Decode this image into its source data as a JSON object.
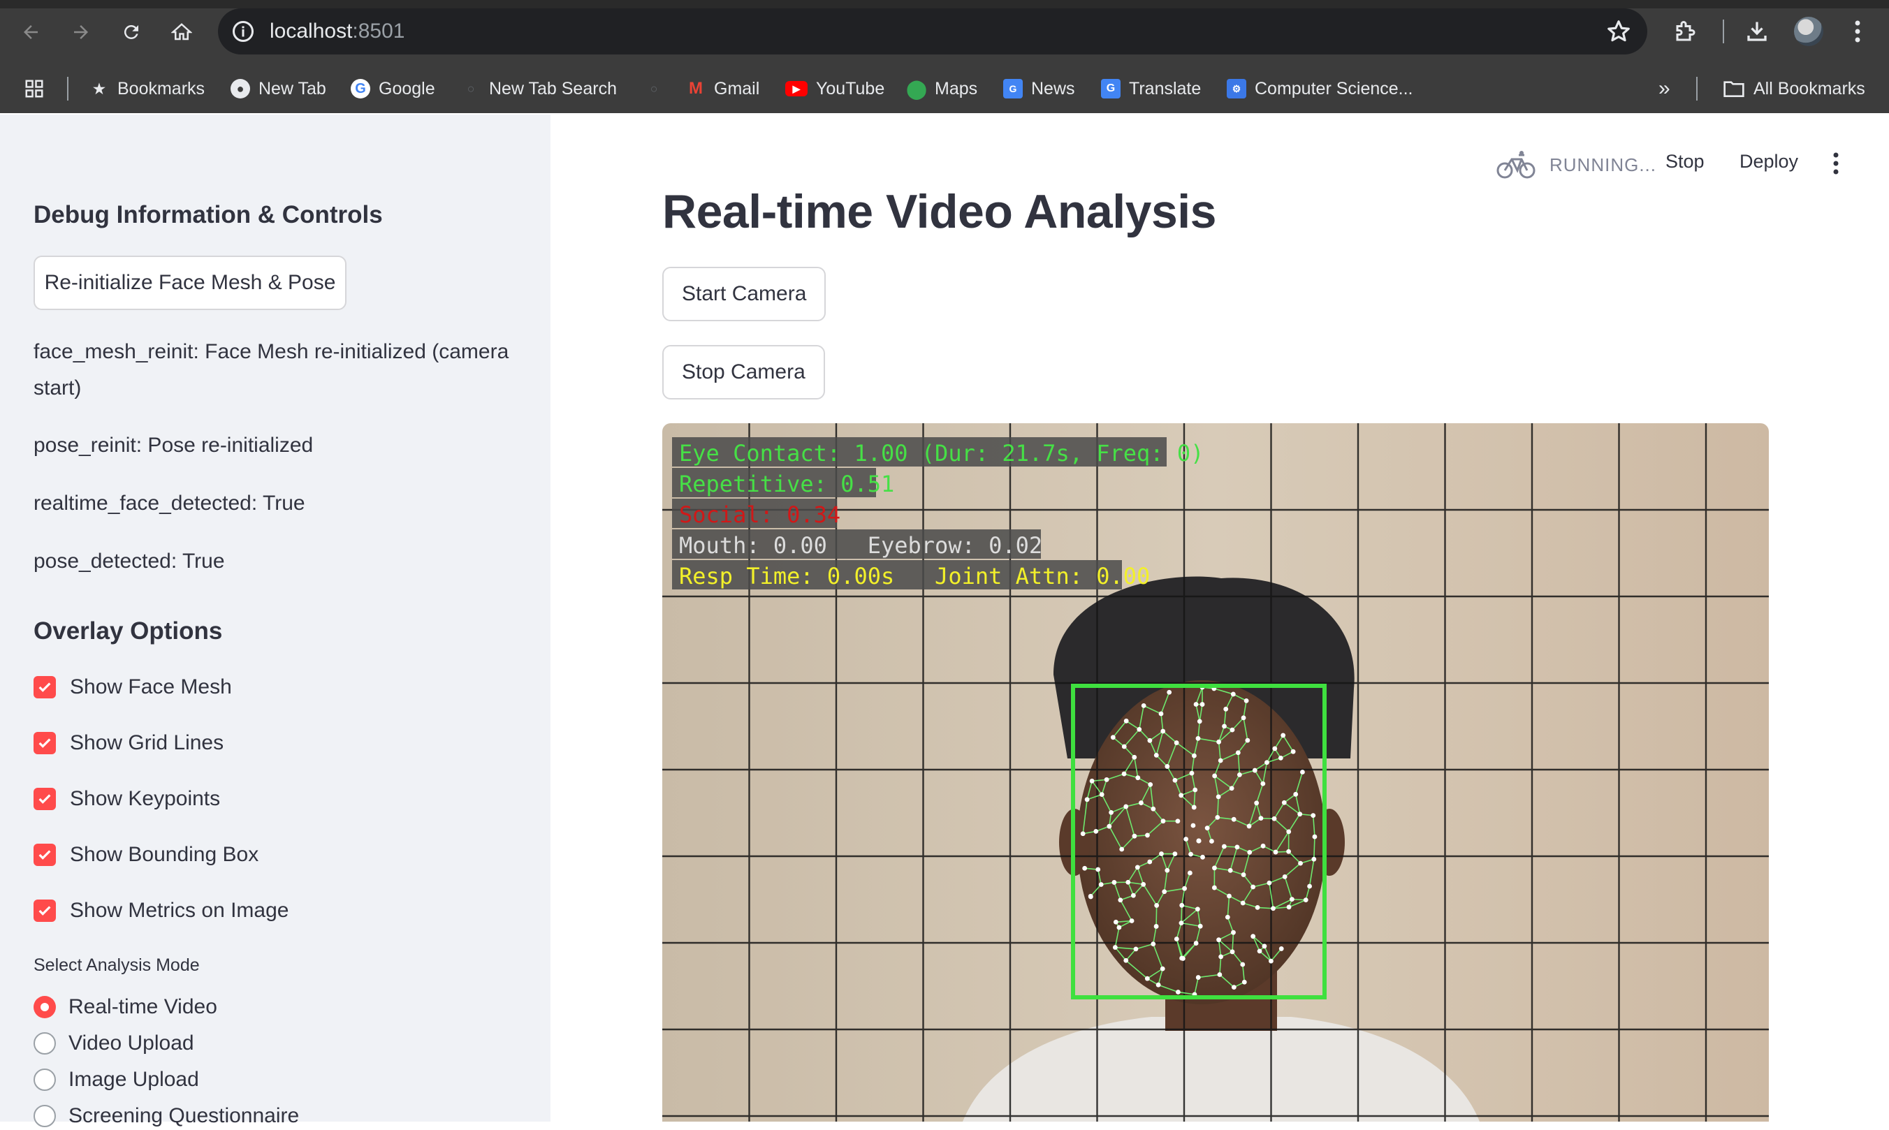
{
  "browser": {
    "url_host": "localhost",
    "url_port": ":8501",
    "bookmarks": [
      {
        "label": "Bookmarks",
        "icon": "star-icon"
      },
      {
        "label": "New Tab",
        "icon": "globe-icon"
      },
      {
        "label": "Google",
        "icon": "google-icon"
      },
      {
        "label": "New Tab Search",
        "icon": "search-icon"
      },
      {
        "label": "Gmail",
        "icon": "gmail-icon"
      },
      {
        "label": "YouTube",
        "icon": "youtube-icon"
      },
      {
        "label": "Maps",
        "icon": "maps-icon"
      },
      {
        "label": "News",
        "icon": "news-icon"
      },
      {
        "label": "Translate",
        "icon": "translate-icon"
      },
      {
        "label": "Computer Science...",
        "icon": "computer-science-icon"
      }
    ],
    "all_bookmarks": "All Bookmarks"
  },
  "sidebar": {
    "debug_heading": "Debug Information & Controls",
    "reinit_button": "Re-initialize Face Mesh & Pose",
    "debug_lines": [
      "face_mesh_reinit: Face Mesh re-initialized (camera start)",
      "pose_reinit: Pose re-initialized",
      "realtime_face_detected: True",
      "pose_detected: True"
    ],
    "overlay_heading": "Overlay Options",
    "overlay_options": [
      {
        "label": "Show Face Mesh",
        "checked": true
      },
      {
        "label": "Show Grid Lines",
        "checked": true
      },
      {
        "label": "Show Keypoints",
        "checked": true
      },
      {
        "label": "Show Bounding Box",
        "checked": true
      },
      {
        "label": "Show Metrics on Image",
        "checked": true
      }
    ],
    "mode_label": "Select Analysis Mode",
    "modes": [
      {
        "label": "Real-time Video",
        "selected": true
      },
      {
        "label": "Video Upload",
        "selected": false
      },
      {
        "label": "Image Upload",
        "selected": false
      },
      {
        "label": "Screening Questionnaire",
        "selected": false
      }
    ]
  },
  "header": {
    "status": "RUNNING...",
    "stop": "Stop",
    "deploy": "Deploy"
  },
  "main": {
    "title": "Real-time Video Analysis",
    "start_camera": "Start Camera",
    "stop_camera": "Stop Camera",
    "overlay_metrics": {
      "eye_contact": "Eye Contact: 1.00 (Dur: 21.7s, Freq: 0)",
      "repetitive": "Repetitive: 0.51",
      "social": "Social: 0.34",
      "mouth_eyebrow": "Mouth: 0.00   Eyebrow: 0.02",
      "resp_joint": "Resp Time: 0.00s   Joint Attn: 0.00"
    }
  },
  "colors": {
    "accent": "#ff4b4b",
    "sidebar_bg": "#f0f2f6",
    "text": "#31333f",
    "overlay_green": "#46e046",
    "overlay_red": "#d01818",
    "overlay_yellow": "#f2f02a"
  }
}
